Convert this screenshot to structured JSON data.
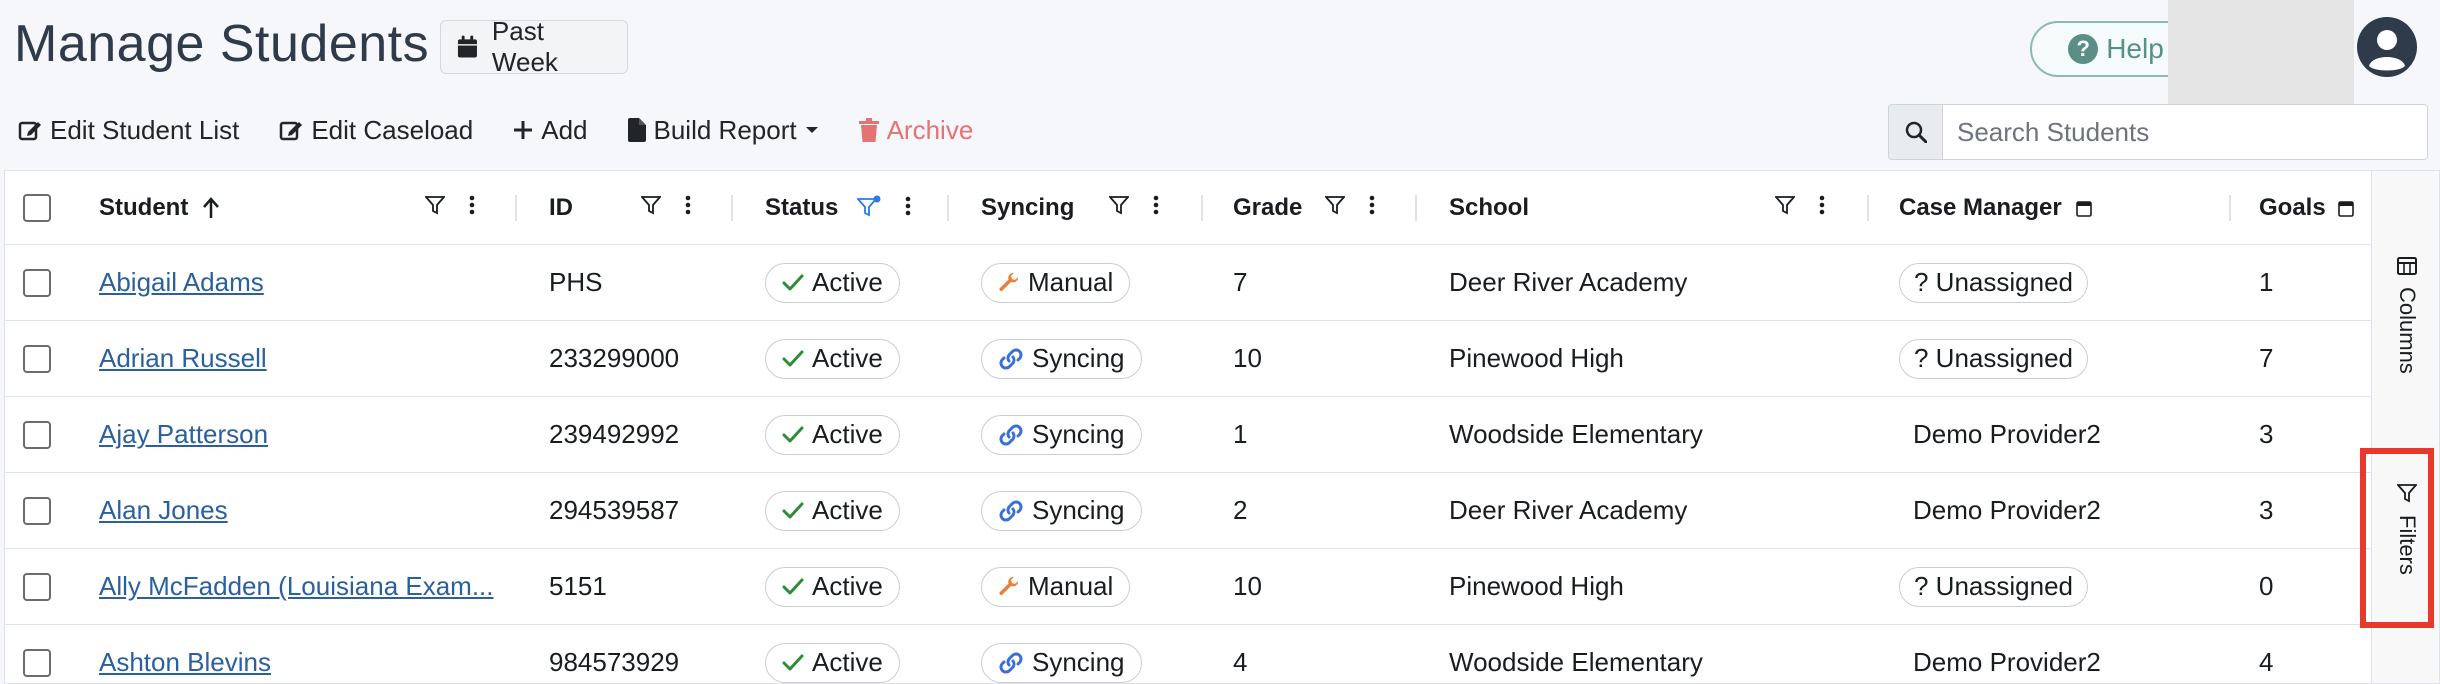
{
  "header": {
    "title": "Manage Students",
    "date_range_label": "Past Week",
    "help_label": "Help"
  },
  "toolbar": {
    "edit_student_list": "Edit Student List",
    "edit_caseload": "Edit Caseload",
    "add": "Add",
    "build_report": "Build Report",
    "archive": "Archive"
  },
  "search": {
    "placeholder": "Search Students",
    "value": ""
  },
  "columns": {
    "student": "Student",
    "id": "ID",
    "status": "Status",
    "syncing": "Syncing",
    "grade": "Grade",
    "school": "School",
    "case_manager": "Case Manager",
    "goals": "Goals"
  },
  "rows": [
    {
      "student": "Abigail Adams",
      "id": "PHS",
      "status": "Active",
      "syncing": "Manual",
      "grade": "7",
      "school": "Deer River Academy",
      "case_manager": "? Unassigned",
      "goals": "1"
    },
    {
      "student": "Adrian Russell",
      "id": "233299000",
      "status": "Active",
      "syncing": "Syncing",
      "grade": "10",
      "school": "Pinewood High",
      "case_manager": "? Unassigned",
      "goals": "7"
    },
    {
      "student": "Ajay Patterson",
      "id": "239492992",
      "status": "Active",
      "syncing": "Syncing",
      "grade": "1",
      "school": "Woodside Elementary",
      "case_manager": "Demo Provider2",
      "goals": "3"
    },
    {
      "student": "Alan Jones",
      "id": "294539587",
      "status": "Active",
      "syncing": "Syncing",
      "grade": "2",
      "school": "Deer River Academy",
      "case_manager": "Demo Provider2",
      "goals": "3"
    },
    {
      "student": "Ally McFadden (Louisiana Exam...",
      "id": "5151",
      "status": "Active",
      "syncing": "Manual",
      "grade": "10",
      "school": "Pinewood High",
      "case_manager": "? Unassigned",
      "goals": "0"
    },
    {
      "student": "Ashton Blevins",
      "id": "984573929",
      "status": "Active",
      "syncing": "Syncing",
      "grade": "4",
      "school": "Woodside Elementary",
      "case_manager": "Demo Provider2",
      "goals": "4"
    }
  ],
  "side_panel": {
    "columns_label": "Columns",
    "filters_label": "Filters"
  },
  "colors": {
    "link": "#2a5fa0",
    "active_check": "#2e8b3a",
    "manual_wrench": "#e8803a",
    "sync_link": "#3a6fd8",
    "highlight": "#e8392c",
    "archive": "#e57373"
  }
}
